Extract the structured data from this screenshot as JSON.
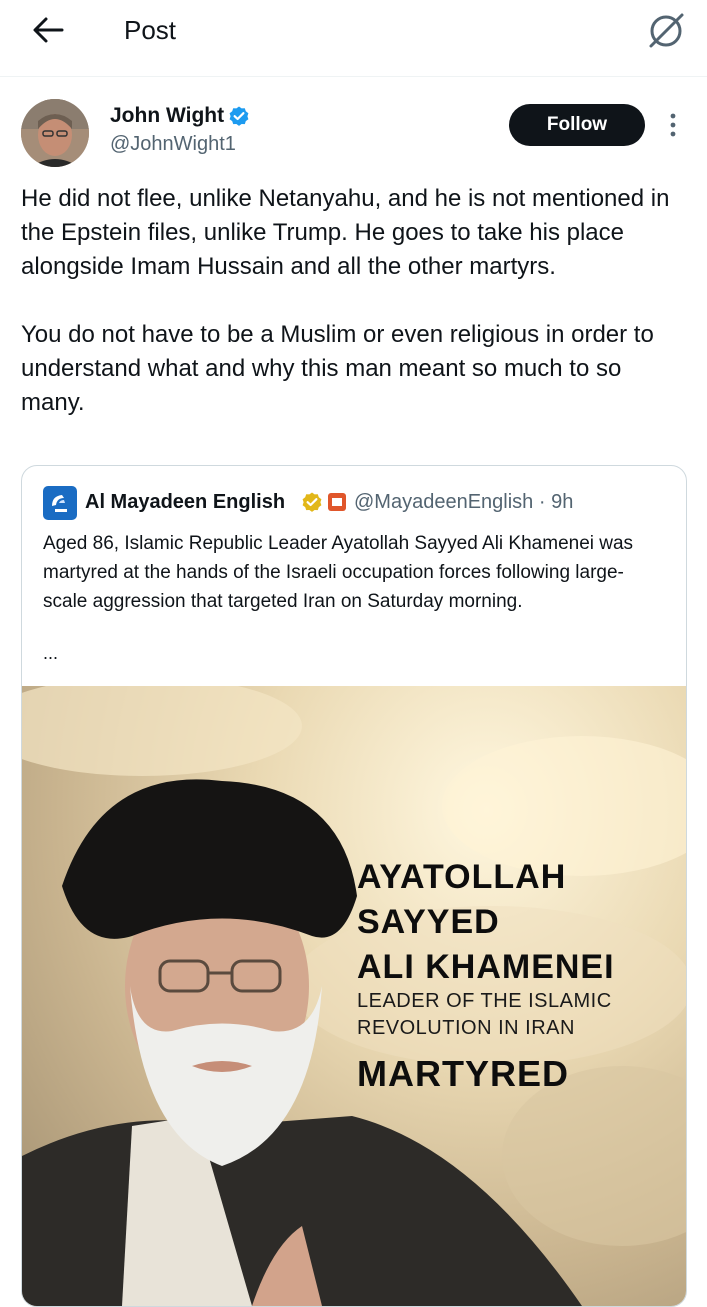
{
  "header": {
    "back_icon": "arrow-left-icon",
    "title": "Post",
    "action_icon": "no-sign-icon"
  },
  "post": {
    "author_name": "John Wight",
    "handle": "@JohnWight1",
    "follow_label": "Follow",
    "text": "He did not flee, unlike Netanyahu, and he is not mentioned in the Epstein files, unlike Trump. He goes to take his place alongside Imam Hussain and all the other martyrs.\n\nYou do not have to be a Muslim or even religious in order to understand what and why this man meant so much to so many.",
    "verified_color": "#1d9bf0"
  },
  "quote": {
    "name": "Al Mayadeen English",
    "handle_time": "@MayadeenEnglish · 9h",
    "text": "Aged 86, Islamic Republic Leader Ayatollah Sayyed Ali Khamenei was martyred at the hands of the Israeli occupation forces following large-scale aggression that targeted Iran on Saturday morning.",
    "ellipsis": "...",
    "image": {
      "line1": "AYATOLLAH",
      "line2": "SAYYED",
      "line3": "ALI KHAMENEI",
      "line4": "LEADER OF THE ISLAMIC",
      "line5": "REVOLUTION IN IRAN",
      "line6": "MARTYRED"
    }
  }
}
